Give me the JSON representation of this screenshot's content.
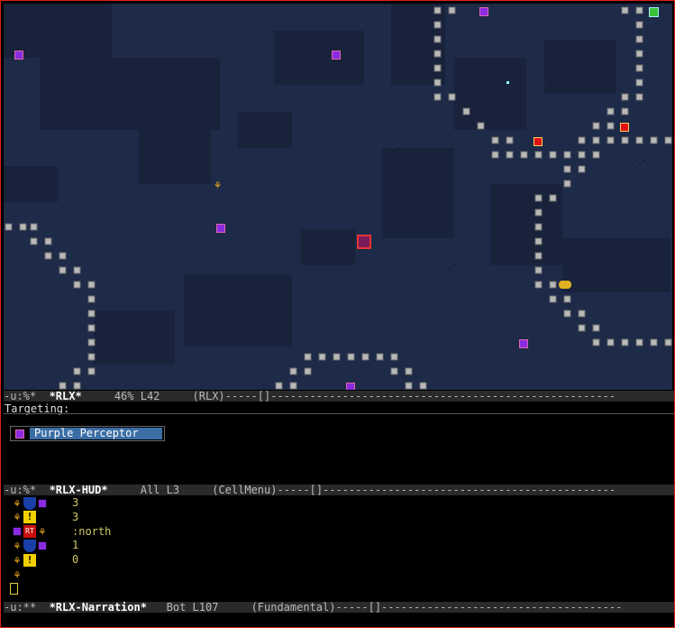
{
  "map": {
    "background": "#1d2a48",
    "wall_color": "#b9b9b9"
  },
  "modelines": {
    "rlx": {
      "status": "-u:%*",
      "buffer": "*RLX*",
      "position": "46% L42",
      "mode": "(RLX)-----[]-----------------------------------------------------"
    },
    "hud": {
      "status": "-u:%*",
      "buffer": "*RLX-HUD*",
      "position": "All L3",
      "mode": "(CellMenu)-----[]---------------------------------------------"
    },
    "narration": {
      "status": "-u:**",
      "buffer": "*RLX-Narration*",
      "position": "Bot L107",
      "mode": "(Fundamental)-----[]-------------------------------------"
    }
  },
  "targeting": {
    "label": "Targeting:",
    "selected_target": "Purple Perceptor"
  },
  "hud": {
    "rows": [
      {
        "icons": [
          "player-icon",
          "shield-icon",
          "purple-gem-icon"
        ],
        "value": "3"
      },
      {
        "icons": [
          "player-icon",
          "alert-icon"
        ],
        "value": "3"
      },
      {
        "icons": [
          "purple-gem-icon",
          "rt-icon",
          "player-icon"
        ],
        "value": ":north"
      },
      {
        "icons": [
          "player-icon",
          "shield-icon",
          "purple-gem-icon"
        ],
        "value": "1"
      },
      {
        "icons": [
          "player-icon",
          "alert-icon"
        ],
        "value": "0"
      },
      {
        "icons": [
          "player-icon"
        ],
        "value": ""
      }
    ]
  },
  "colors": {
    "modeline_bg": "#2a2a2a",
    "selection_bg": "#3b6ea5",
    "value_text": "#cfc864",
    "frame": "#d21"
  }
}
